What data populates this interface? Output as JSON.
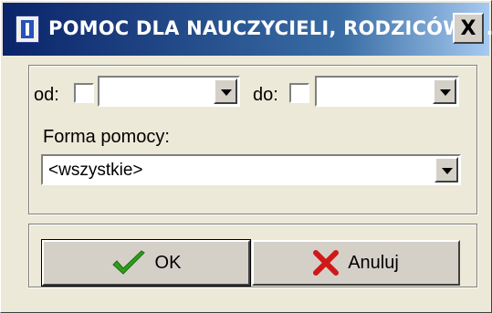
{
  "window": {
    "title": "POMOC DLA NAUCZYCIELI, RODZICÓW ...",
    "close_label": "X"
  },
  "filters": {
    "from_label": "od:",
    "from_checked": false,
    "from_value": "",
    "to_label": "do:",
    "to_checked": false,
    "to_value": ""
  },
  "form": {
    "label": "Forma pomocy:",
    "value": "<wszystkie>"
  },
  "buttons": {
    "ok_label": "OK",
    "cancel_label": "Anuluj"
  },
  "icons": {
    "title": "app-i-icon",
    "ok": "checkmark-icon",
    "cancel": "x-cross-icon"
  },
  "colors": {
    "titlebar_start": "#0a246a",
    "titlebar_end": "#a6caf0",
    "face": "#ece9d8",
    "ok_check": "#2e9e1a",
    "cancel_x": "#d01818"
  }
}
